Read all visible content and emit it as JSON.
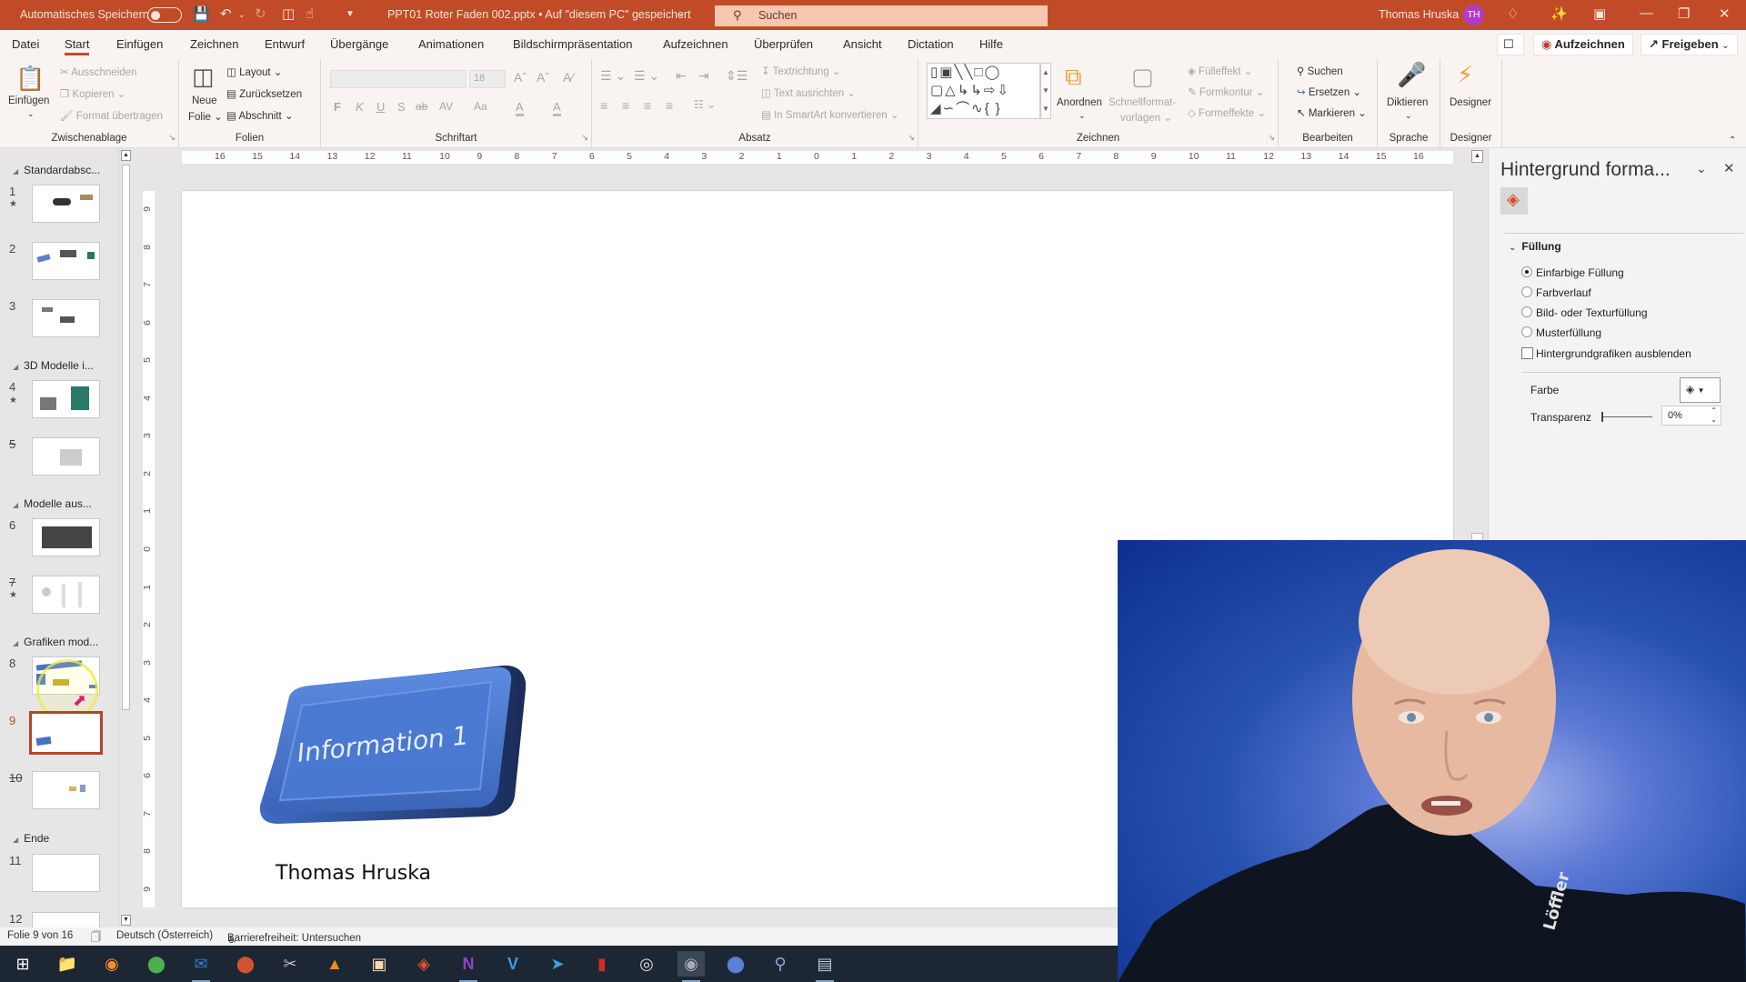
{
  "titlebar": {
    "autosave_label": "Automatisches Speichern",
    "autosave_state": "off",
    "doc_title": "PPT01 Roter Faden 002.pptx • Auf \"diesem PC\" gespeichert",
    "search_placeholder": "Suchen",
    "user_name": "Thomas Hruska",
    "user_initials": "TH",
    "qat_icons": [
      "save-icon",
      "undo-icon",
      "redo-icon",
      "present-icon",
      "touch-mode-icon",
      "customize-icon"
    ],
    "window_icons": [
      "premium-diamond-icon",
      "magic-wand-icon",
      "ribbon-display-icon",
      "minimize-icon",
      "restore-icon",
      "close-icon"
    ]
  },
  "tabs": [
    "Datei",
    "Start",
    "Einfügen",
    "Zeichnen",
    "Entwurf",
    "Übergänge",
    "Animationen",
    "Bildschirmpräsentation",
    "Aufzeichnen",
    "Überprüfen",
    "Ansicht",
    "Dictation",
    "Hilfe"
  ],
  "active_tab": "Start",
  "top_actions": {
    "comments_icon": "comment-icon",
    "record": "Aufzeichnen",
    "share": "Freigeben"
  },
  "ribbon": {
    "zwischenablage": {
      "label": "Zwischenablage",
      "paste": "Einfügen",
      "cut": "Ausschneiden",
      "copy": "Kopieren",
      "format_painter": "Format übertragen"
    },
    "folien": {
      "label": "Folien",
      "new_slide_1": "Neue",
      "new_slide_2": "Folie",
      "layout": "Layout",
      "reset": "Zurücksetzen",
      "section": "Abschnitt"
    },
    "schriftart": {
      "label": "Schriftart",
      "font_name": "",
      "font_size": "18",
      "bold": "F",
      "italic": "K",
      "underline": "U",
      "shadow": "S",
      "strike": "ab",
      "spacing": "AV",
      "case": "Aa",
      "highlight": "A",
      "color": "A"
    },
    "absatz": {
      "label": "Absatz",
      "text_direction": "Textrichtung",
      "align_text": "Text ausrichten",
      "smartart": "In SmartArt konvertieren"
    },
    "zeichnen": {
      "label": "Zeichnen",
      "arrange": "Anordnen",
      "quick_styles_1": "Schnellformat-",
      "quick_styles_2": "vorlagen",
      "fill": "Fülleffekt",
      "outline": "Formkontur",
      "effects": "Formeffekte"
    },
    "bearbeiten": {
      "label": "Bearbeiten",
      "find": "Suchen",
      "replace": "Ersetzen",
      "select": "Markieren"
    },
    "sprache": {
      "label": "Sprache",
      "dictate": "Diktieren"
    },
    "designer": {
      "label": "Designer",
      "designer": "Designer"
    }
  },
  "ruler": {
    "horizontal": [
      "16",
      "15",
      "14",
      "13",
      "12",
      "11",
      "10",
      "9",
      "8",
      "7",
      "6",
      "5",
      "4",
      "3",
      "2",
      "1",
      "0",
      "1",
      "2",
      "3",
      "4",
      "5",
      "6",
      "7",
      "8",
      "9",
      "10",
      "11",
      "12",
      "13",
      "14",
      "15",
      "16"
    ],
    "vertical": [
      "9",
      "8",
      "7",
      "6",
      "5",
      "4",
      "3",
      "2",
      "1",
      "0",
      "1",
      "2",
      "3",
      "4",
      "5",
      "6",
      "7",
      "8",
      "9"
    ]
  },
  "slides_panel": {
    "sections": [
      {
        "name": "Standardabsc...",
        "slides": [
          {
            "n": "1",
            "star": true
          },
          {
            "n": "2",
            "star": false
          },
          {
            "n": "3",
            "star": false
          }
        ]
      },
      {
        "name": "3D Modelle i...",
        "slides": [
          {
            "n": "4",
            "star": true
          },
          {
            "n": "5",
            "star": false,
            "hidden": true
          }
        ]
      },
      {
        "name": "Modelle aus...",
        "slides": [
          {
            "n": "6",
            "star": false
          },
          {
            "n": "7",
            "star": true,
            "hidden": true
          }
        ]
      },
      {
        "name": "Grafiken mod...",
        "slides": [
          {
            "n": "8",
            "star": false
          },
          {
            "n": "9",
            "star": false,
            "selected": true
          },
          {
            "n": "10",
            "star": false,
            "hidden": true
          }
        ]
      },
      {
        "name": "Ende",
        "slides": [
          {
            "n": "11",
            "star": false
          },
          {
            "n": "12",
            "star": false
          }
        ]
      }
    ]
  },
  "slide": {
    "shape_text": "Information 1",
    "shape_color": "#4472c4",
    "author": "Thomas Hruska"
  },
  "format_pane": {
    "title": "Hintergrund forma...",
    "section": "Füllung",
    "options": [
      {
        "label": "Einfarbige Füllung",
        "checked": true
      },
      {
        "label": "Farbverlauf",
        "checked": false
      },
      {
        "label": "Bild- oder Texturfüllung",
        "checked": false
      },
      {
        "label": "Musterfüllung",
        "checked": false
      }
    ],
    "hide_graphics_label": "Hintergrundgrafiken ausblenden",
    "hide_graphics_checked": false,
    "color_label": "Farbe",
    "transparency_label": "Transparenz",
    "transparency_value": "0%"
  },
  "status": {
    "slide_info": "Folie 9 von 16",
    "language": "Deutsch (Österreich)",
    "accessibility": "Barrierefreiheit: Untersuchen"
  },
  "taskbar": {
    "apps": [
      "windows-start",
      "file-explorer",
      "firefox",
      "chrome",
      "outlook",
      "powerpoint",
      "snipping-tool",
      "vlc",
      "office-lens",
      "app-orange",
      "onenote",
      "v-app",
      "telegram",
      "acrobat",
      "obs",
      "recorder",
      "blue-app",
      "magnifier",
      "system-app"
    ]
  },
  "colors": {
    "accent": "#c24b27",
    "ribbon_bg": "#f9f3f1",
    "selected_slide_border": "#b2462a"
  }
}
